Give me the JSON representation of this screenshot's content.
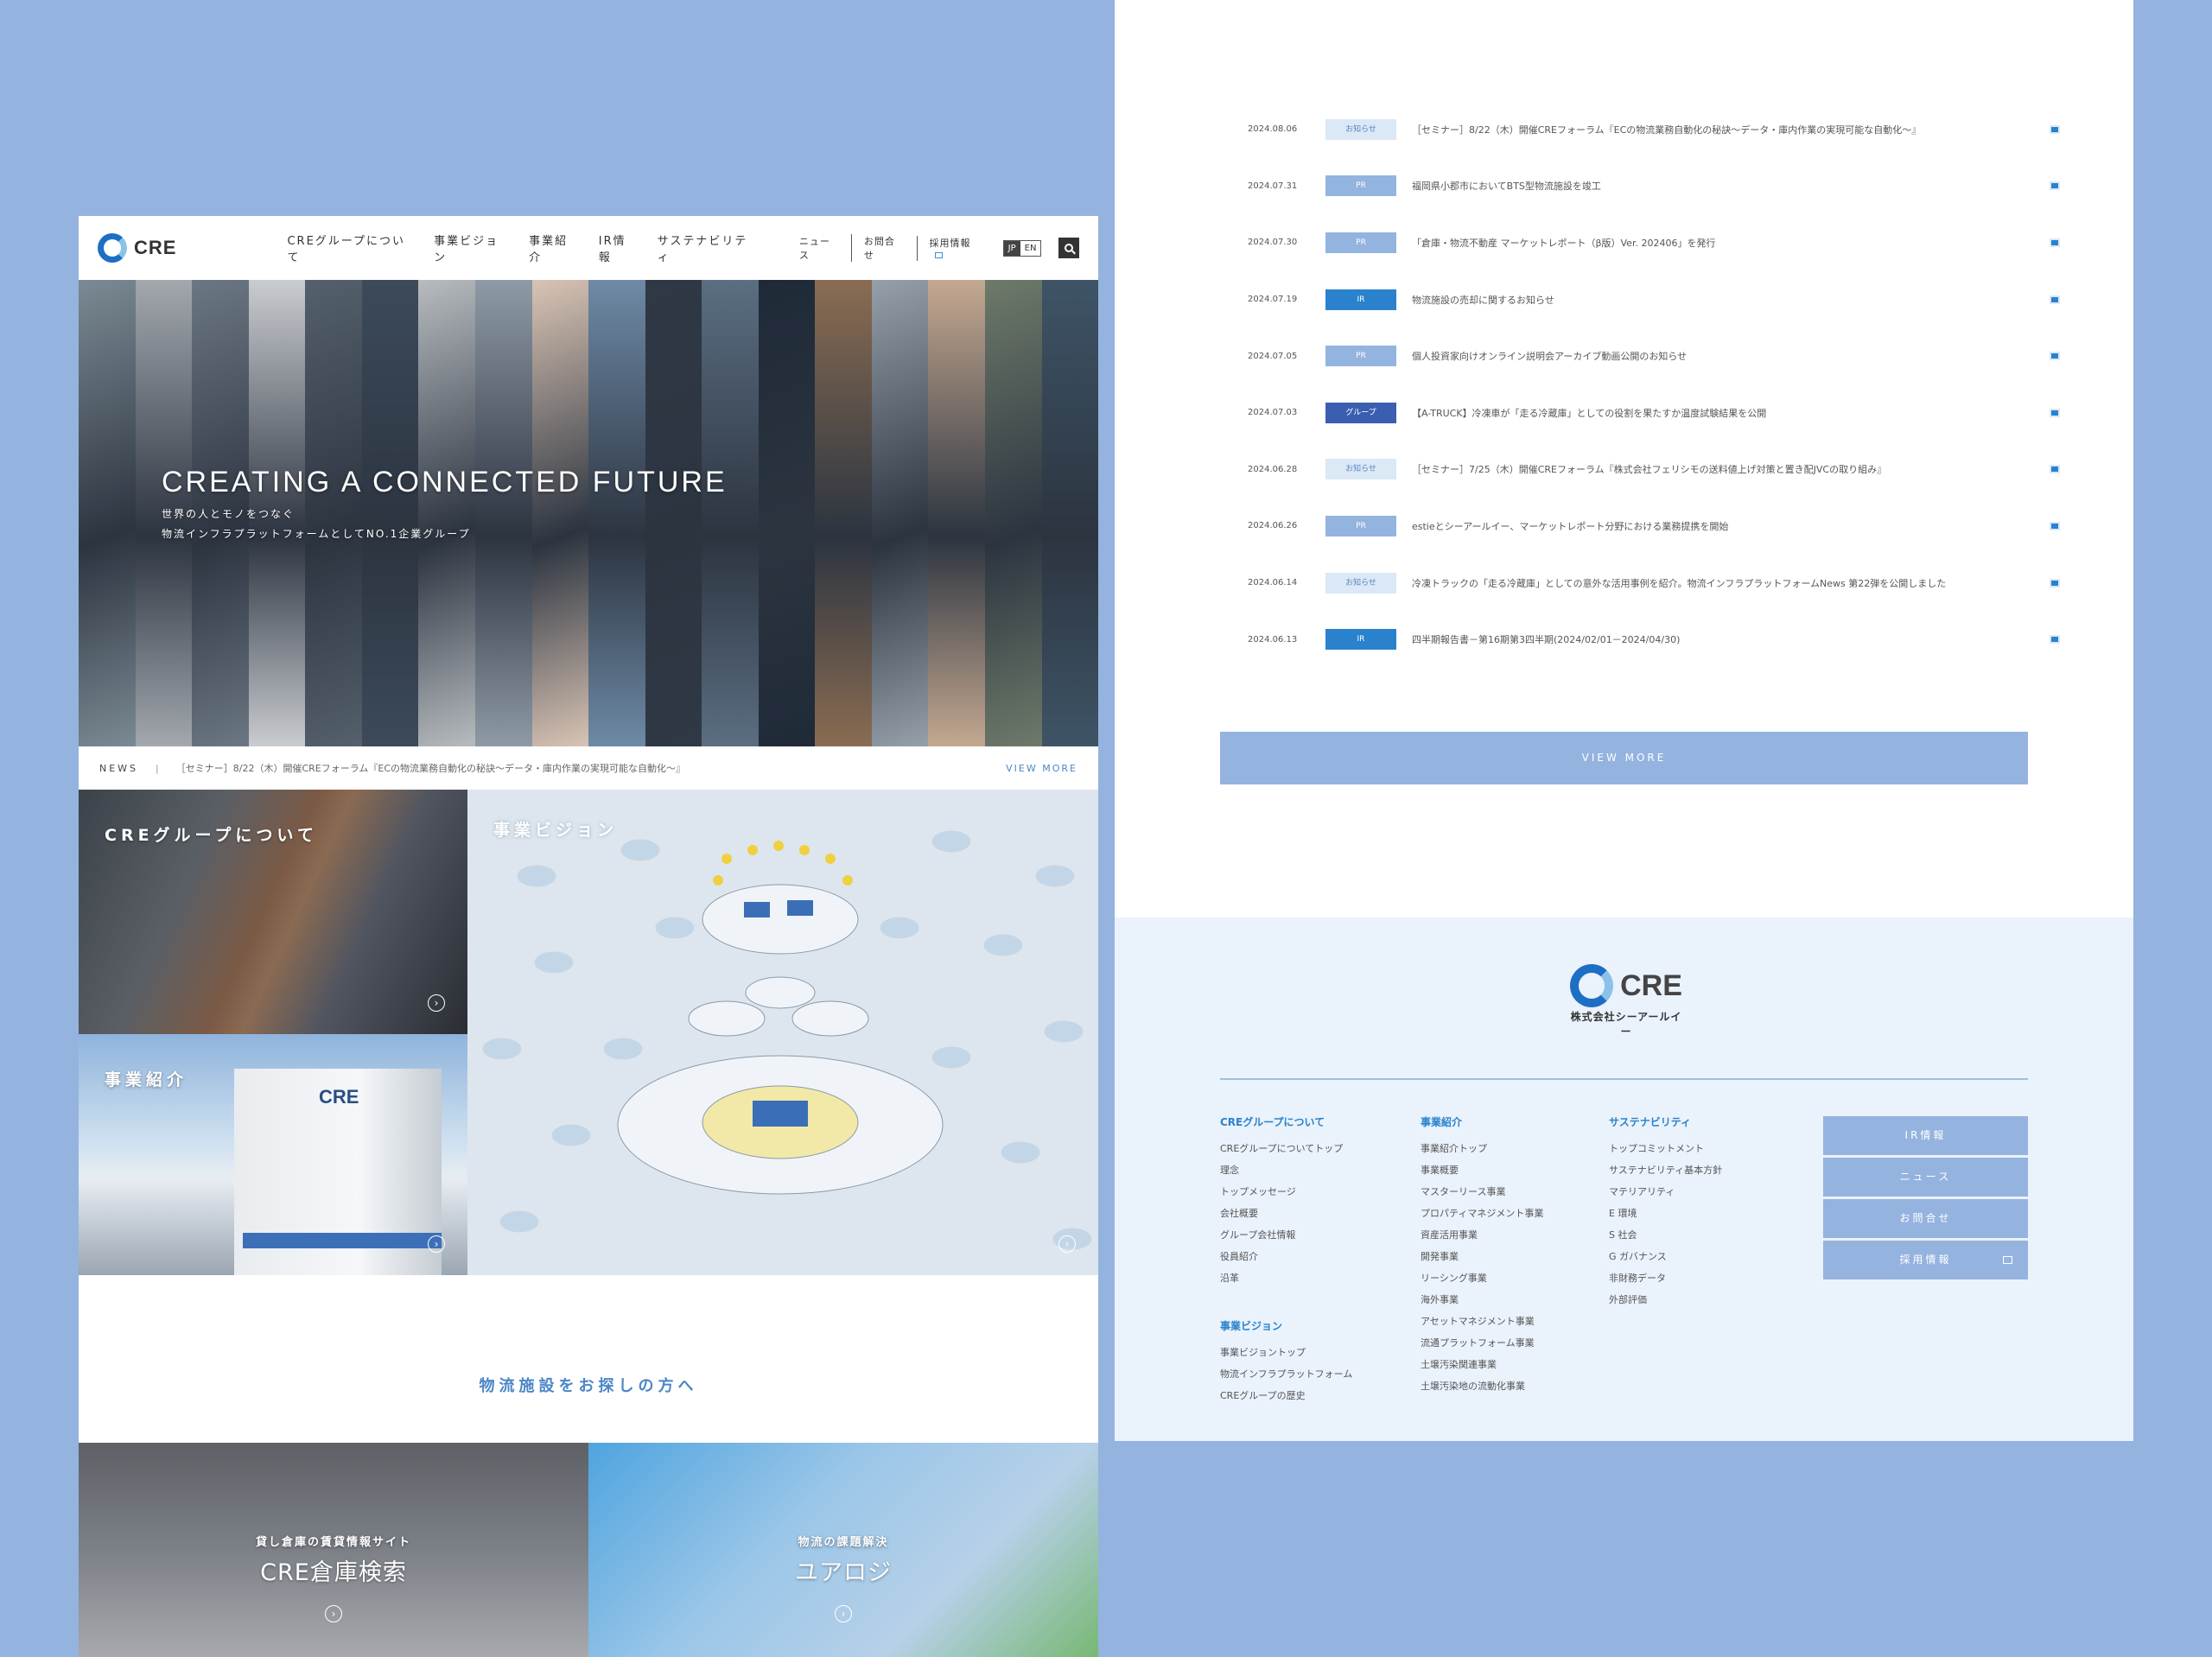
{
  "left": {
    "header": {
      "logo_text": "CRE",
      "nav": [
        "CREグループについて",
        "事業ビジョン",
        "事業紹介",
        "IR情報",
        "サステナビリティ"
      ],
      "subnav": [
        "ニュース",
        "お問合せ",
        "採用情報"
      ],
      "lang": {
        "jp": "JP",
        "en": "EN"
      }
    },
    "hero": {
      "title": "CREATING A CONNECTED FUTURE",
      "sub1": "世界の人とモノをつなぐ",
      "sub2": "物流インフラプラットフォームとしてNO.1企業グループ",
      "strip_colors": [
        "#7b8a94",
        "#a3a8ae",
        "#6c7784",
        "#c9ccd0",
        "#55606d",
        "#3c4a5a",
        "#b8bcc0",
        "#8e9aa6",
        "#d9c4b4",
        "#6e8aa6",
        "#2f3945",
        "#5b6e82",
        "#1f2a38",
        "#8a6c52",
        "#95a0aa",
        "#c4a890",
        "#6e7a6a",
        "#3e5466"
      ]
    },
    "newsbar": {
      "label": "NEWS",
      "sep": "|",
      "text": "［セミナー］8/22（木）開催CREフォーラム『ECの物流業務自動化の秘訣～データ・庫内作業の実現可能な自動化～』",
      "more": "VIEW MORE"
    },
    "tiles": {
      "about": "CREグループについて",
      "vision": "事業ビジョン",
      "business": "事業紹介",
      "business_logo": "CRE",
      "arrow": "›"
    },
    "find_title": "物流施設をお探しの方へ",
    "bottom": {
      "warehouse_cap": "貸し倉庫の賃貸情報サイト",
      "warehouse_title": "CRE倉庫検索",
      "yourlogi_cap": "物流の課題解決",
      "yourlogi_title": "ユアロジ"
    }
  },
  "news": [
    {
      "date": "2024.08.06",
      "badge": "お知らせ",
      "type": "notice",
      "title": "［セミナー］8/22（木）開催CREフォーラム『ECの物流業務自動化の秘訣～データ・庫内作業の実現可能な自動化～』"
    },
    {
      "date": "2024.07.31",
      "badge": "PR",
      "type": "pr",
      "title": "福岡県小郡市においてBTS型物流施設を竣工"
    },
    {
      "date": "2024.07.30",
      "badge": "PR",
      "type": "pr",
      "title": "「倉庫・物流不動産 マーケットレポート（β版）Ver. 202406」を発行"
    },
    {
      "date": "2024.07.19",
      "badge": "IR",
      "type": "ir",
      "title": "物流施設の売却に関するお知らせ"
    },
    {
      "date": "2024.07.05",
      "badge": "PR",
      "type": "pr",
      "title": "個人投資家向けオンライン説明会アーカイブ動画公開のお知らせ"
    },
    {
      "date": "2024.07.03",
      "badge": "グループ",
      "type": "group",
      "title": "【A-TRUCK】冷凍車が「走る冷蔵庫」としての役割を果たすか温度試験結果を公開"
    },
    {
      "date": "2024.06.28",
      "badge": "お知らせ",
      "type": "notice",
      "title": "［セミナー］7/25（木）開催CREフォーラム『株式会社フェリシモの送料値上げ対策と置き配JVCの取り組み』"
    },
    {
      "date": "2024.06.26",
      "badge": "PR",
      "type": "pr",
      "title": "estieとシーアールイー、マーケットレポート分野における業務提携を開始"
    },
    {
      "date": "2024.06.14",
      "badge": "お知らせ",
      "type": "notice",
      "title": "冷凍トラックの「走る冷蔵庫」としての意外な活用事例を紹介。物流インフラプラットフォームNews 第22弾を公開しました"
    },
    {
      "date": "2024.06.13",
      "badge": "IR",
      "type": "ir",
      "title": "四半期報告書－第16期第3四半期(2024/02/01－2024/04/30)"
    }
  ],
  "view_more": "VIEW MORE",
  "footer": {
    "logo_text": "CRE",
    "company": "株式会社シーアールイー",
    "col1_head": "CREグループについて",
    "col1_links": [
      "CREグループについてトップ",
      "理念",
      "トップメッセージ",
      "会社概要",
      "グループ会社情報",
      "役員紹介",
      "沿革"
    ],
    "col1b_head": "事業ビジョン",
    "col1b_links": [
      "事業ビジョントップ",
      "物流インフラプラットフォーム",
      "CREグループの歴史"
    ],
    "col2_head": "事業紹介",
    "col2_links": [
      "事業紹介トップ",
      "事業概要",
      "マスターリース事業",
      "プロパティマネジメント事業",
      "資産活用事業",
      "開発事業",
      "リーシング事業",
      "海外事業",
      "アセットマネジメント事業",
      "流通プラットフォーム事業",
      "土壌汚染関連事業",
      "土壌汚染地の流動化事業"
    ],
    "col3_head": "サステナビリティ",
    "col3_links": [
      "トップコミットメント",
      "サステナビリティ基本方針",
      "マテリアリティ",
      "E 環境",
      "S 社会",
      "G ガバナンス",
      "非財務データ",
      "外部評価"
    ],
    "buttons": [
      "IR情報",
      "ニュース",
      "お問合せ",
      "採用情報"
    ]
  }
}
